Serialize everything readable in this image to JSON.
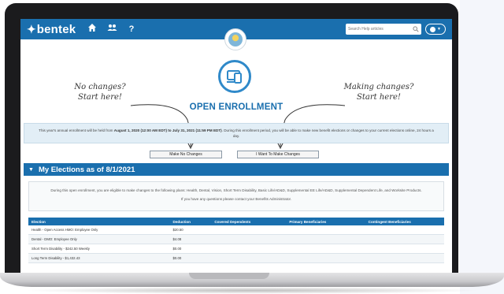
{
  "nav": {
    "brand": "bentek",
    "home_icon": "home-icon",
    "people_icon": "people-icon",
    "help_icon": "help-icon",
    "help_glyph": "?",
    "search_placeholder": "Search Help articles"
  },
  "annotations": {
    "left": [
      "No changes?",
      "Start here!"
    ],
    "right": [
      "Making changes?",
      "Start here!"
    ]
  },
  "enrollment": {
    "title": "OPEN ENROLLMENT",
    "notice_prefix": "This year's annual enrollment will be held from ",
    "notice_dates": "August 1, 2020 (12:00 AM EDT) to July 31, 2021 (11:59 PM EDT)",
    "notice_suffix": ". During this enrollment period, you will be able to make new benefit elections or changes to your current elections online, 24 hours a day.",
    "btn_no_changes": "Make No Changes",
    "btn_changes": "I Want To Make Changes"
  },
  "elections": {
    "header": "My Elections as of 8/1/2021",
    "info_line1": "During this open enrollment, you are eligible to make changes to the following plans: Health, Dental, Vision, Short Term Disability, Basic Life/AD&D, Supplemental EE Life/AD&D, Supplemental Dependent Life, and Worksite Products.",
    "info_line2": "If you have any questions please contact your Benefits Administrator.",
    "columns": [
      "Election",
      "Deduction",
      "Covered Dependents",
      "Primary Beneficiaries",
      "Contingent Beneficiaries"
    ],
    "rows": [
      [
        "Health - Open Access HMO: Employee Only",
        "$20.50",
        "",
        "",
        ""
      ],
      [
        "Dental - DMO: Employee Only",
        "$4.08",
        "",
        "",
        ""
      ],
      [
        "Short Term Disability - $242.50 Weekly",
        "$0.00",
        "",
        "",
        ""
      ],
      [
        "Long Term Disability - $1,432.43",
        "$0.00",
        "",
        "",
        ""
      ]
    ]
  },
  "colors": {
    "primary": "#1a6fae",
    "notice_bg": "#e2eef6"
  }
}
